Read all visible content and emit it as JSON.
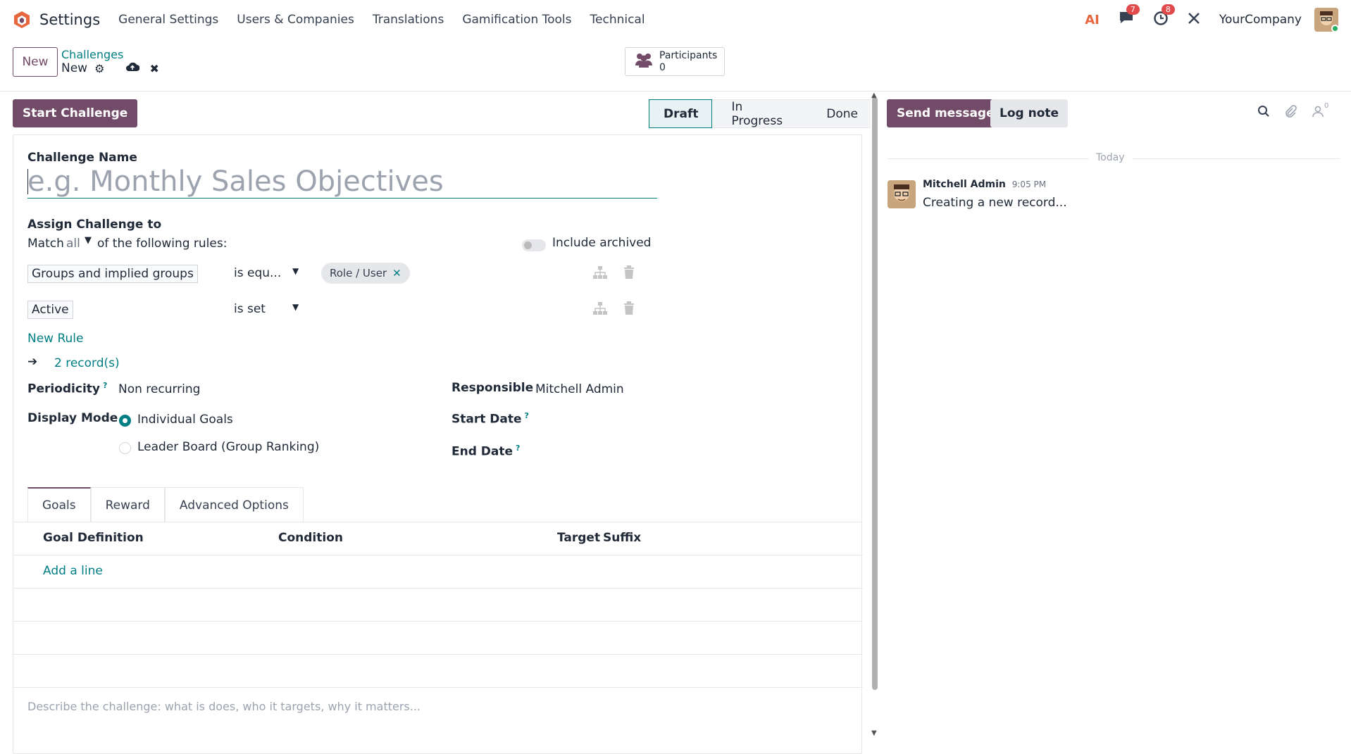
{
  "topnav": {
    "app_name": "Settings",
    "menu": [
      "General Settings",
      "Users & Companies",
      "Translations",
      "Gamification Tools",
      "Technical"
    ],
    "ai_icon": "AI",
    "messages_badge": "7",
    "activities_badge": "8",
    "company": "YourCompany"
  },
  "control": {
    "new_label": "New",
    "breadcrumb_parent": "Challenges",
    "breadcrumb_current": "New",
    "participants_label": "Participants",
    "participants_count": "0"
  },
  "form": {
    "start_challenge_label": "Start Challenge",
    "stages": [
      "Draft",
      "In Progress",
      "Done"
    ],
    "active_stage": "Draft",
    "challenge_name_label": "Challenge Name",
    "challenge_name_placeholder": "e.g. Monthly Sales Objectives",
    "assign_label": "Assign Challenge to",
    "match_prefix": "Match",
    "match_value": "all",
    "match_suffix": "of the following rules:",
    "include_archived_label": "Include archived",
    "rules": [
      {
        "field": "Groups and implied groups",
        "operator": "is equ...",
        "value": "Role / User"
      },
      {
        "field": "Active",
        "operator": "is set",
        "value": ""
      }
    ],
    "new_rule_label": "New Rule",
    "records_label": "2 record(s)",
    "periodicity_label": "Periodicity",
    "periodicity_value": "Non recurring",
    "responsible_label": "Responsible",
    "responsible_value": "Mitchell Admin",
    "display_mode_label": "Display Mode",
    "display_options": [
      "Individual Goals",
      "Leader Board (Group Ranking)"
    ],
    "start_date_label": "Start Date",
    "end_date_label": "End Date",
    "help_mark": "?",
    "tabs": [
      "Goals",
      "Reward",
      "Advanced Options"
    ],
    "columns": [
      "Goal Definition",
      "Condition",
      "Target",
      "Suffix"
    ],
    "add_line_label": "Add a line",
    "description_placeholder": "Describe the challenge: what is does, who it targets, why it matters..."
  },
  "chatter": {
    "send_message_label": "Send message",
    "log_note_label": "Log note",
    "followers_count": "0",
    "today_label": "Today",
    "message_author": "Mitchell Admin",
    "message_time": "9:05 PM",
    "message_body": "Creating a new record..."
  },
  "colors": {
    "brand": "#714b67",
    "accent": "#017e84",
    "badge": "#e04a4a"
  }
}
